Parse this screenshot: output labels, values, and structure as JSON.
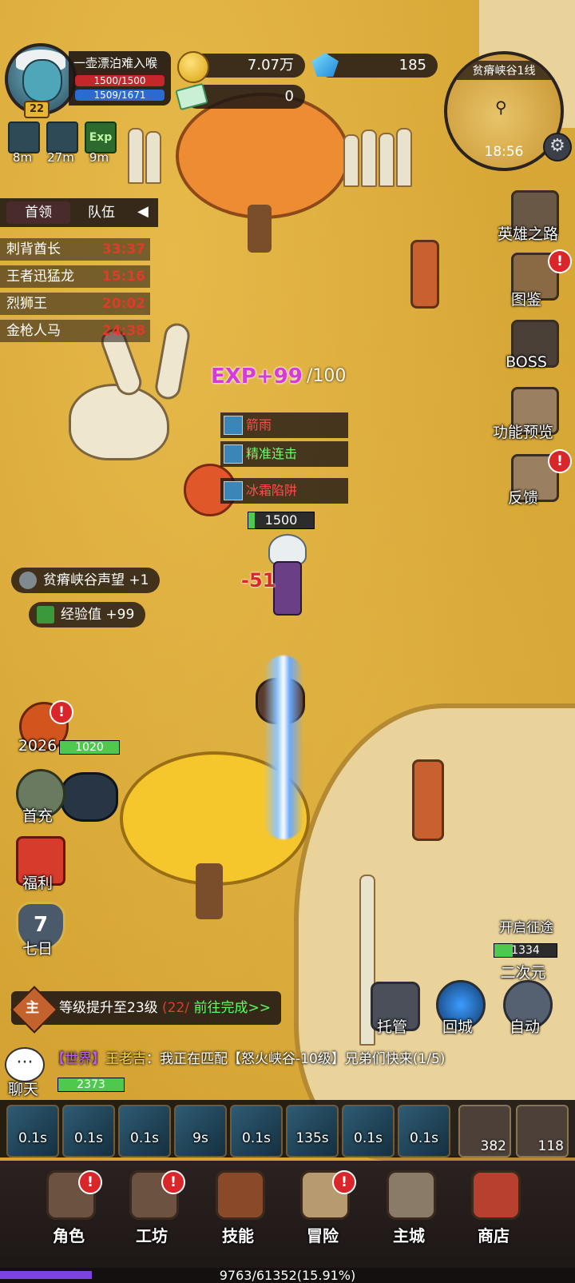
{
  "player": {
    "name": "一壶漂泊难入喉",
    "level": "22",
    "hp": "1500/1500",
    "mp": "1509/1671"
  },
  "resources": {
    "gold": "7.07万",
    "gems": "185",
    "tickets": "0"
  },
  "minimap": {
    "title": "贫瘠峡谷1线",
    "time": "18:56"
  },
  "buffs": [
    {
      "time": "8m"
    },
    {
      "time": "27m"
    },
    {
      "time": "9m"
    }
  ],
  "boss_panel": {
    "tabs": [
      "首领",
      "队伍"
    ],
    "rows": [
      {
        "name": "刺背酋长",
        "time": "33:37"
      },
      {
        "name": "王者迅猛龙",
        "time": "15:16"
      },
      {
        "name": "烈狮王",
        "time": "20:02"
      },
      {
        "name": "金枪人马",
        "time": "24:38"
      }
    ]
  },
  "right_menu": [
    "英雄之路",
    "图鉴",
    "BOSS",
    "功能预览",
    "反馈"
  ],
  "left_menu": {
    "event_year": "2026",
    "items": [
      "首充",
      "福利",
      "七日"
    ],
    "seven_day_num": "7"
  },
  "floating": {
    "exp": "EXP+99",
    "exp_base": "/100",
    "skills": [
      "箭雨",
      "精准连击",
      "冰霜陷阱"
    ],
    "hero_hp": "1500",
    "damage": "-51",
    "reputation": "贫瘠峡谷声望 +1",
    "exp_gain": "经验值 +99",
    "enemy_hp": "1020",
    "ally_hp": "1334",
    "ally_title": "开启征途",
    "ally_name": "二次元",
    "chat_hp": "2373"
  },
  "quest": {
    "badge": "主",
    "text": "等级提升至23级",
    "count": "(22/",
    "action": "前往完成>>"
  },
  "chat": {
    "label": "聊天",
    "channel": "【世界】",
    "speaker": "王老吉",
    "message": "：我正在匹配【怒火峡谷-10级】兄弟们快来(1/5)"
  },
  "action_buttons": [
    "托管",
    "回城",
    "自动"
  ],
  "skills": [
    "0.1s",
    "0.1s",
    "0.1s",
    "9s",
    "0.1s",
    "135s",
    "0.1s",
    "0.1s"
  ],
  "items": [
    "382",
    "118"
  ],
  "nav": [
    "角色",
    "工坊",
    "技能",
    "冒险",
    "主城",
    "商店"
  ],
  "exp_bar": {
    "text": "9763/61352(15.91%)",
    "progress": 0.1591
  },
  "colors": {
    "hp": "#c3272a",
    "mp": "#2a6bd1",
    "alert": "#d8262a",
    "exp_bar": "#7b43e0"
  }
}
